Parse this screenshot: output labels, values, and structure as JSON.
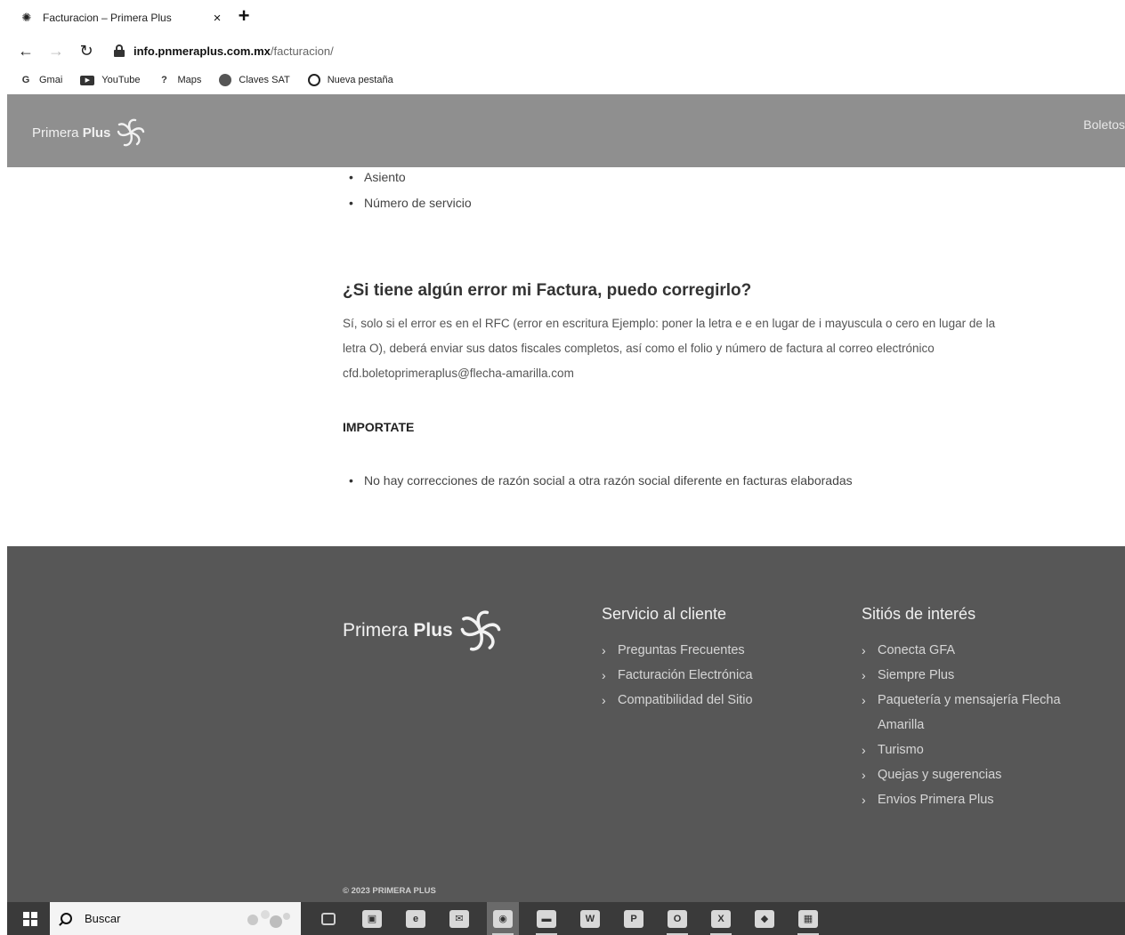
{
  "browser": {
    "tab_title": "Facturacion – Primera Plus",
    "tab_close": "×",
    "new_tab": "+",
    "url_host": "info.pnmeraplus.com.mx",
    "url_path": "/facturacion/",
    "bookmarks": [
      {
        "label": "Gmai",
        "icon": "gmail-icon"
      },
      {
        "label": "YouTube",
        "icon": "youtube-icon"
      },
      {
        "label": "Maps",
        "icon": "maps-icon"
      },
      {
        "label": "Claves SAT",
        "icon": "bookmark-dot-icon"
      },
      {
        "label": "Nueva pestaña",
        "icon": "globe-icon"
      }
    ]
  },
  "header": {
    "logo_text_1": "Primera",
    "logo_text_2": "Plus",
    "nav_link": "Boletos"
  },
  "content": {
    "list_top": [
      "Asiento",
      "Número de servicio"
    ],
    "question": "¿Si tiene algún error mi Factura, puedo corregirlo?",
    "answer": "Sí, solo si el error es en el RFC (error en escritura Ejemplo: poner la letra e e en lugar de i mayuscula o cero en lugar de la letra O), deberá enviar sus datos fiscales completos, así como el folio y número de factura al correo electrónico cfd.boletoprimeraplus@flecha-amarilla.com",
    "important_heading": "IMPORTATE",
    "list_bottom": [
      "No hay correcciones de razón social a otra razón social diferente en facturas elaboradas"
    ]
  },
  "footer": {
    "logo_text_1": "Primera",
    "logo_text_2": "Plus",
    "col1_title": "Servicio al cliente",
    "col1_links": [
      "Preguntas Frecuentes",
      "Facturación Electrónica",
      "Compatibilidad del Sitio"
    ],
    "col2_title": "Sitiós de interés",
    "col2_links": [
      "Conecta GFA",
      "Siempre Plus",
      "Paquetería y mensajería Flecha Amarilla",
      "Turismo",
      "Quejas y sugerencias",
      "Envios Primera Plus"
    ],
    "copyright": "© 2023 PRIMERA PLUS",
    "chevron": "›"
  },
  "taskbar": {
    "search_label": "Buscar",
    "apps": [
      {
        "name": "task-view-icon",
        "glyph": ""
      },
      {
        "name": "store-icon",
        "glyph": "▣"
      },
      {
        "name": "edge-icon",
        "glyph": "e"
      },
      {
        "name": "mail-icon",
        "glyph": "✉"
      },
      {
        "name": "chrome-icon",
        "glyph": "◉"
      },
      {
        "name": "file-explorer-icon",
        "glyph": "▬"
      },
      {
        "name": "word-icon",
        "glyph": "W"
      },
      {
        "name": "powerpoint-icon",
        "glyph": "P"
      },
      {
        "name": "outlook-icon",
        "glyph": "O"
      },
      {
        "name": "excel-icon",
        "glyph": "X"
      },
      {
        "name": "app-icon",
        "glyph": "◆"
      },
      {
        "name": "calculator-icon",
        "glyph": "▦"
      }
    ]
  }
}
